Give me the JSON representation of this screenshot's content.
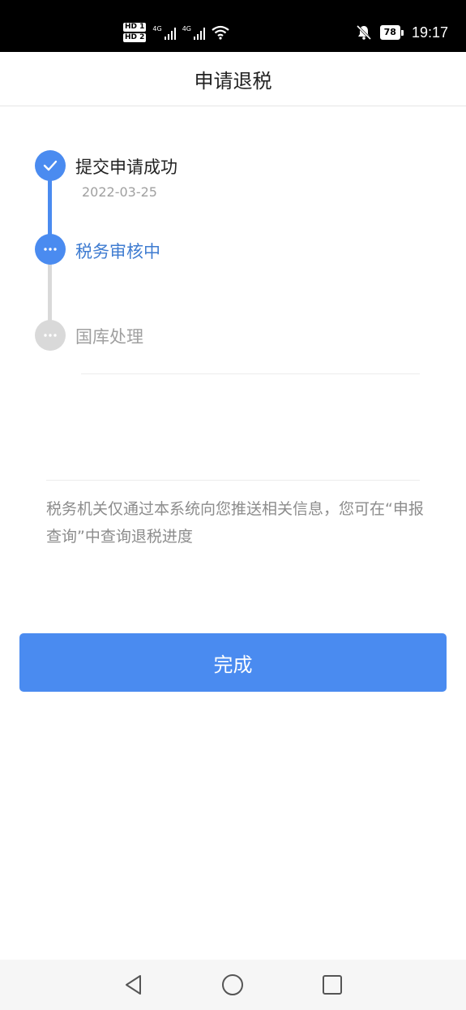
{
  "status_bar": {
    "hd1": "HD 1",
    "hd2": "HD 2",
    "net1": "4G",
    "net2": "4G",
    "battery": "78",
    "time": "19:17"
  },
  "header": {
    "title": "申请退税"
  },
  "progress": {
    "steps": [
      {
        "title": "提交申请成功",
        "date": "2022-03-25",
        "state": "done"
      },
      {
        "title": "税务审核中",
        "state": "current"
      },
      {
        "title": "国库处理",
        "state": "pending"
      }
    ]
  },
  "notice": {
    "text": "税务机关仅通过本系统向您推送相关信息，您可在“申报查询”中查询退税进度"
  },
  "actions": {
    "done_label": "完成"
  },
  "colors": {
    "accent": "#4a8bf0",
    "current_text": "#3f7cd1",
    "pending": "#d9d9d9",
    "muted_text": "#a0a0a0"
  },
  "icons": {
    "done": "check-icon",
    "current": "ellipsis-icon",
    "pending": "ellipsis-icon",
    "sys_back": "back-triangle-icon",
    "sys_home": "home-circle-icon",
    "sys_recent": "recent-square-icon"
  }
}
